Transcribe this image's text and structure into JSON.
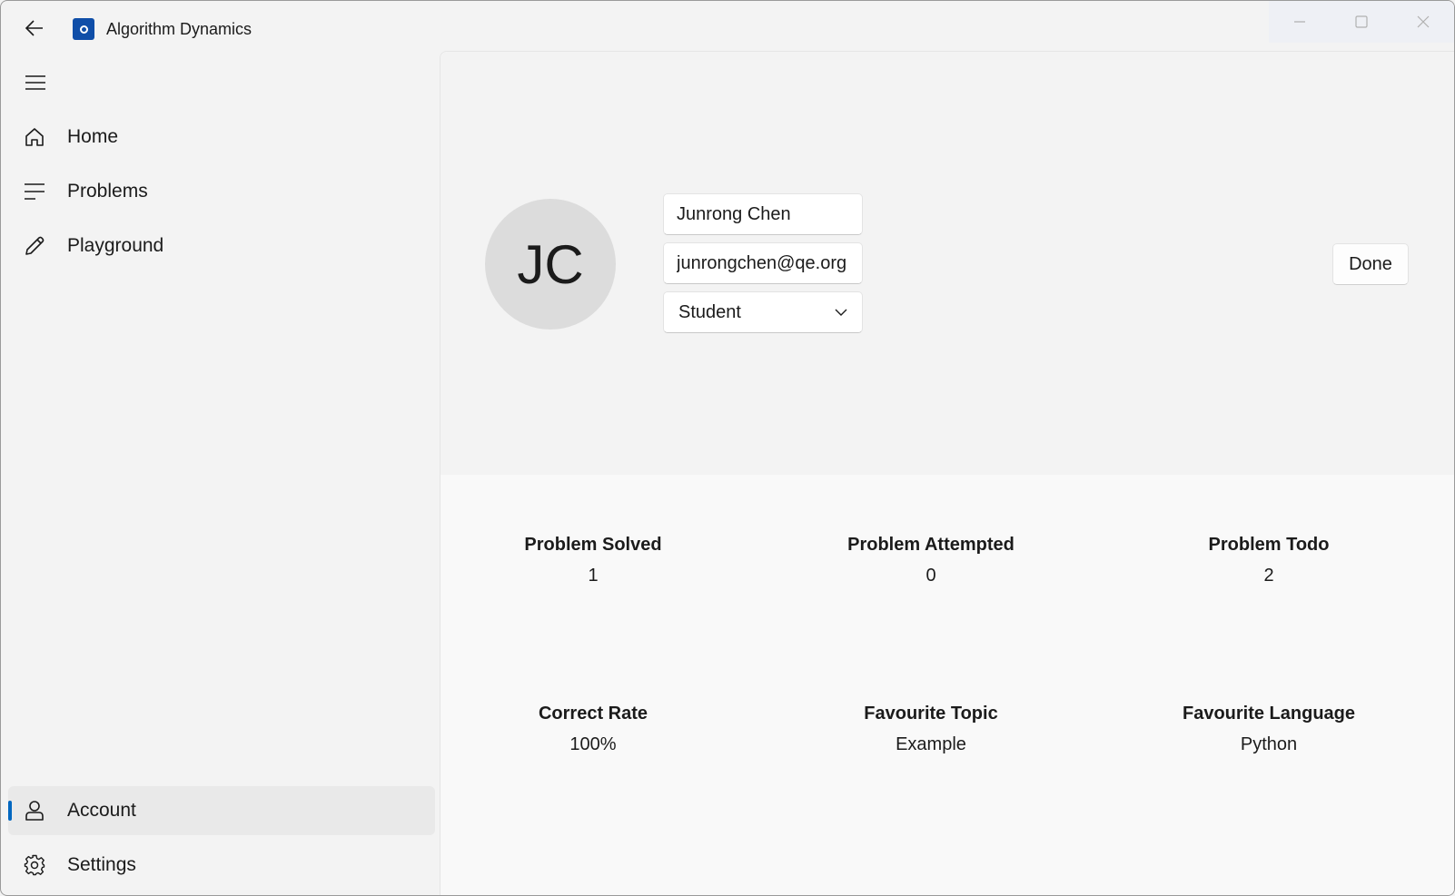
{
  "window": {
    "title": "Algorithm Dynamics"
  },
  "nav": {
    "items": [
      {
        "label": "Home",
        "icon": "home-icon"
      },
      {
        "label": "Problems",
        "icon": "list-icon"
      },
      {
        "label": "Playground",
        "icon": "pencil-icon"
      }
    ],
    "footer_items": [
      {
        "label": "Account",
        "icon": "person-icon",
        "selected": true
      },
      {
        "label": "Settings",
        "icon": "gear-icon",
        "selected": false
      }
    ]
  },
  "profile": {
    "initials": "JC",
    "name": "Junrong Chen",
    "email": "junrongchen@qe.org",
    "role": "Student",
    "done_label": "Done"
  },
  "stats": [
    {
      "label": "Problem Solved",
      "value": "1"
    },
    {
      "label": "Problem Attempted",
      "value": "0"
    },
    {
      "label": "Problem Todo",
      "value": "2"
    },
    {
      "label": "Correct Rate",
      "value": "100%"
    },
    {
      "label": "Favourite Topic",
      "value": "Example"
    },
    {
      "label": "Favourite Language",
      "value": "Python"
    }
  ],
  "colors": {
    "accent": "#0067c0",
    "app_icon": "#0f4ea8"
  }
}
